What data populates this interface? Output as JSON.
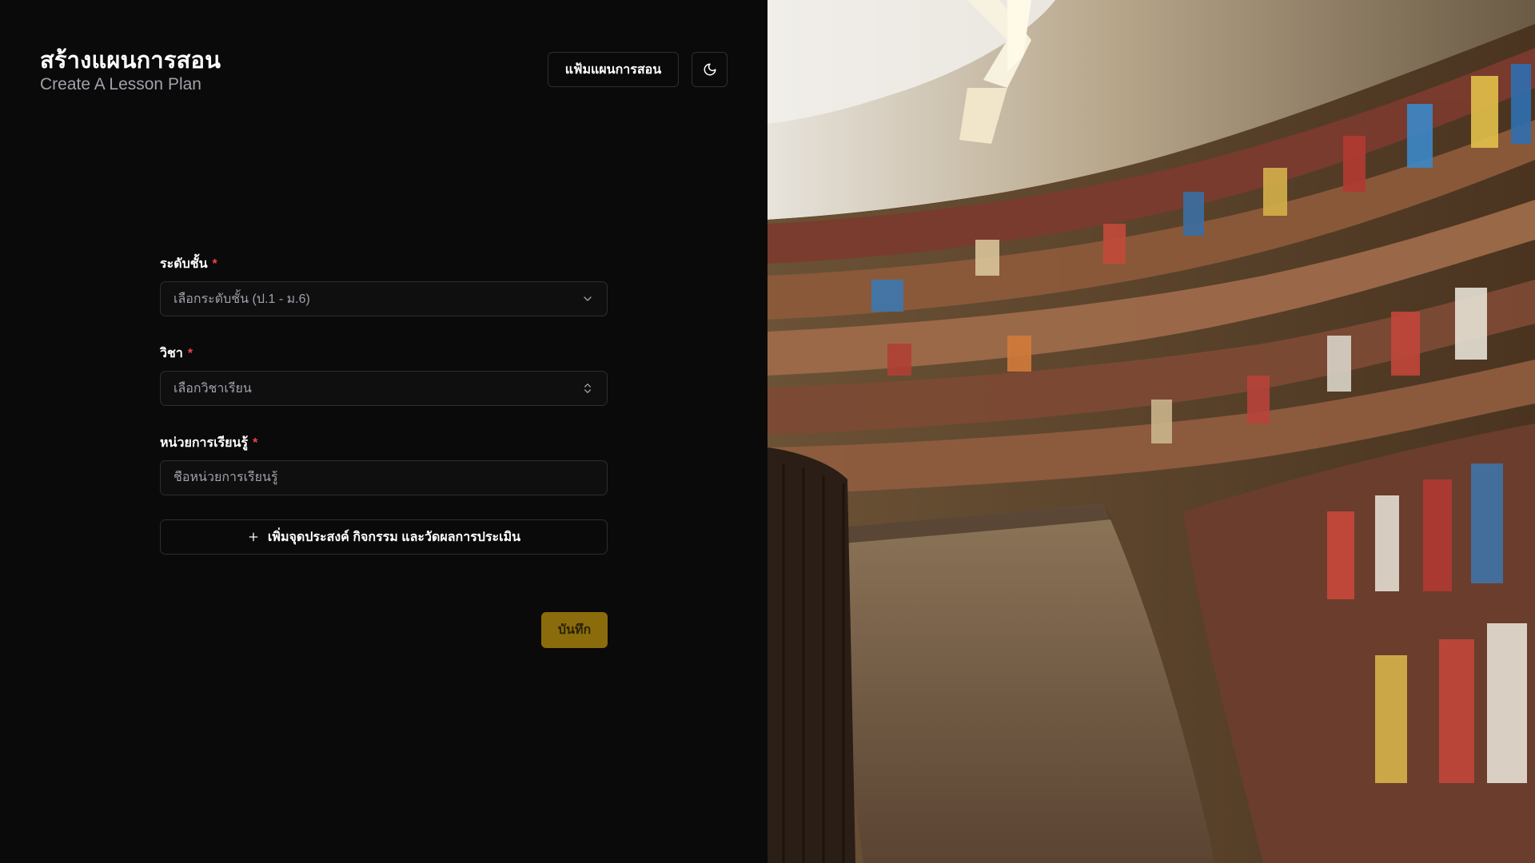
{
  "header": {
    "title": "สร้างแผนการสอน",
    "subtitle": "Create A Lesson Plan",
    "portfolio_button": "แฟ้มแผนการสอน",
    "theme_toggle_icon": "moon-icon"
  },
  "form": {
    "grade": {
      "label": "ระดับชั้น",
      "required_mark": "*",
      "placeholder": "เลือกระดับชั้น (ป.1 - ม.6)"
    },
    "subject": {
      "label": "วิชา",
      "required_mark": "*",
      "placeholder": "เลือกวิชาเรียน"
    },
    "unit": {
      "label": "หน่วยการเรียนรู้",
      "required_mark": "*",
      "placeholder": "ชื่อหน่วยการเรียนรู้"
    },
    "add_button": "เพิ่มจุดประสงค์ กิจกรรม และวัดผลการประเมิน",
    "save_button": "บันทึก"
  },
  "colors": {
    "background": "#0a0a0a",
    "accent": "#8a6c0c",
    "required": "#ef4444"
  },
  "hero_image": "library-bookshelves-photo"
}
